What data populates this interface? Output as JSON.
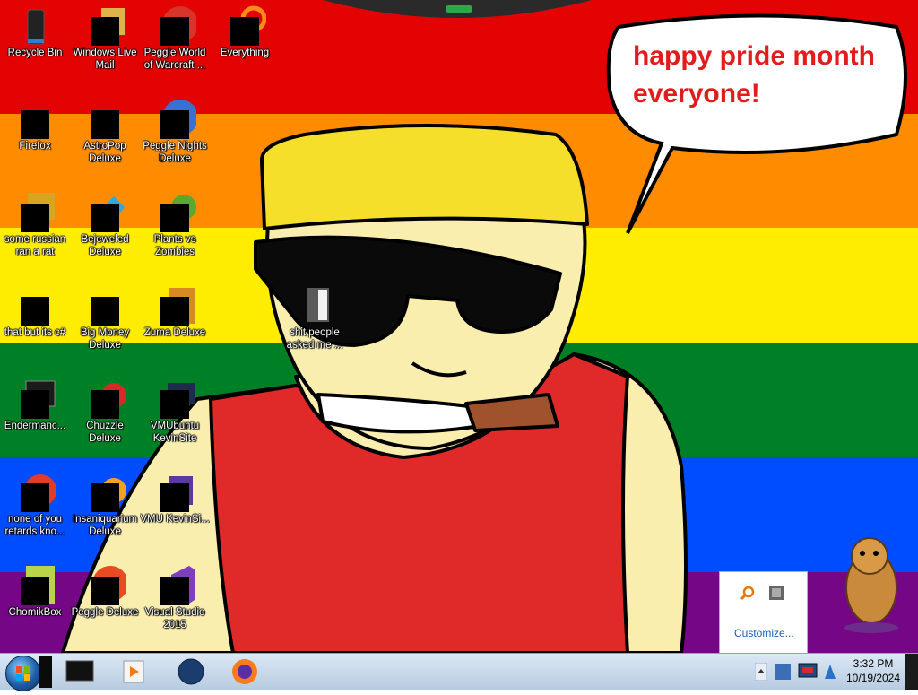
{
  "wallpaper": {
    "stripes": [
      "#e40303",
      "#ff8c00",
      "#ffed00",
      "#008026",
      "#004dff",
      "#750787"
    ],
    "speech_bubble_text_line1": "happy pride month",
    "speech_bubble_text_line2": "everyone!",
    "speech_color": "#e21c1c"
  },
  "desktop_icons": [
    {
      "label": "Recycle Bin",
      "icon": "recycle-bin-icon"
    },
    {
      "label": "Windows Live Mail",
      "icon": "mail-icon"
    },
    {
      "label": "Peggle World of Warcraft ...",
      "icon": "peggle-icon"
    },
    {
      "label": "Everything",
      "icon": "search-icon"
    },
    {
      "label": "Firefox",
      "icon": "firefox-icon"
    },
    {
      "label": "AstroPop Deluxe",
      "icon": "astropop-icon"
    },
    {
      "label": "Peggle Nights Deluxe",
      "icon": "peggle-nights-icon"
    },
    {
      "label": "some russian ran a rat",
      "icon": "app-icon"
    },
    {
      "label": "Bejeweled Deluxe",
      "icon": "gem-icon"
    },
    {
      "label": "Plants vs Zombies",
      "icon": "plant-icon"
    },
    {
      "label": "that but its c#",
      "icon": "folder-stack-icon"
    },
    {
      "label": "Big Money Deluxe",
      "icon": "money-bag-icon"
    },
    {
      "label": "Zuma Deluxe",
      "icon": "zuma-icon"
    },
    {
      "label": "Endermanc...",
      "icon": "terminal-icon"
    },
    {
      "label": "Chuzzle Deluxe",
      "icon": "chuzzle-icon"
    },
    {
      "label": "VMUbuntu KevinSite",
      "icon": "vm-icon"
    },
    {
      "label": "none of you retards kno...",
      "icon": "app-icon"
    },
    {
      "label": "Insaniquarium Deluxe",
      "icon": "fish-icon"
    },
    {
      "label": "VMU KevinSi...",
      "icon": "vm-icon"
    },
    {
      "label": "ChomikBox",
      "icon": "chomikbox-icon"
    },
    {
      "label": "Peggle Deluxe",
      "icon": "peggle-icon"
    },
    {
      "label": "Visual Studio 2015",
      "icon": "visual-studio-icon"
    },
    {
      "label": "shit people asked me ...",
      "icon": "folder-icon"
    }
  ],
  "tray_popup": {
    "customize_label": "Customize..."
  },
  "taskbar": {
    "clock_time": "3:32 PM",
    "clock_date": "10/19/2024"
  }
}
